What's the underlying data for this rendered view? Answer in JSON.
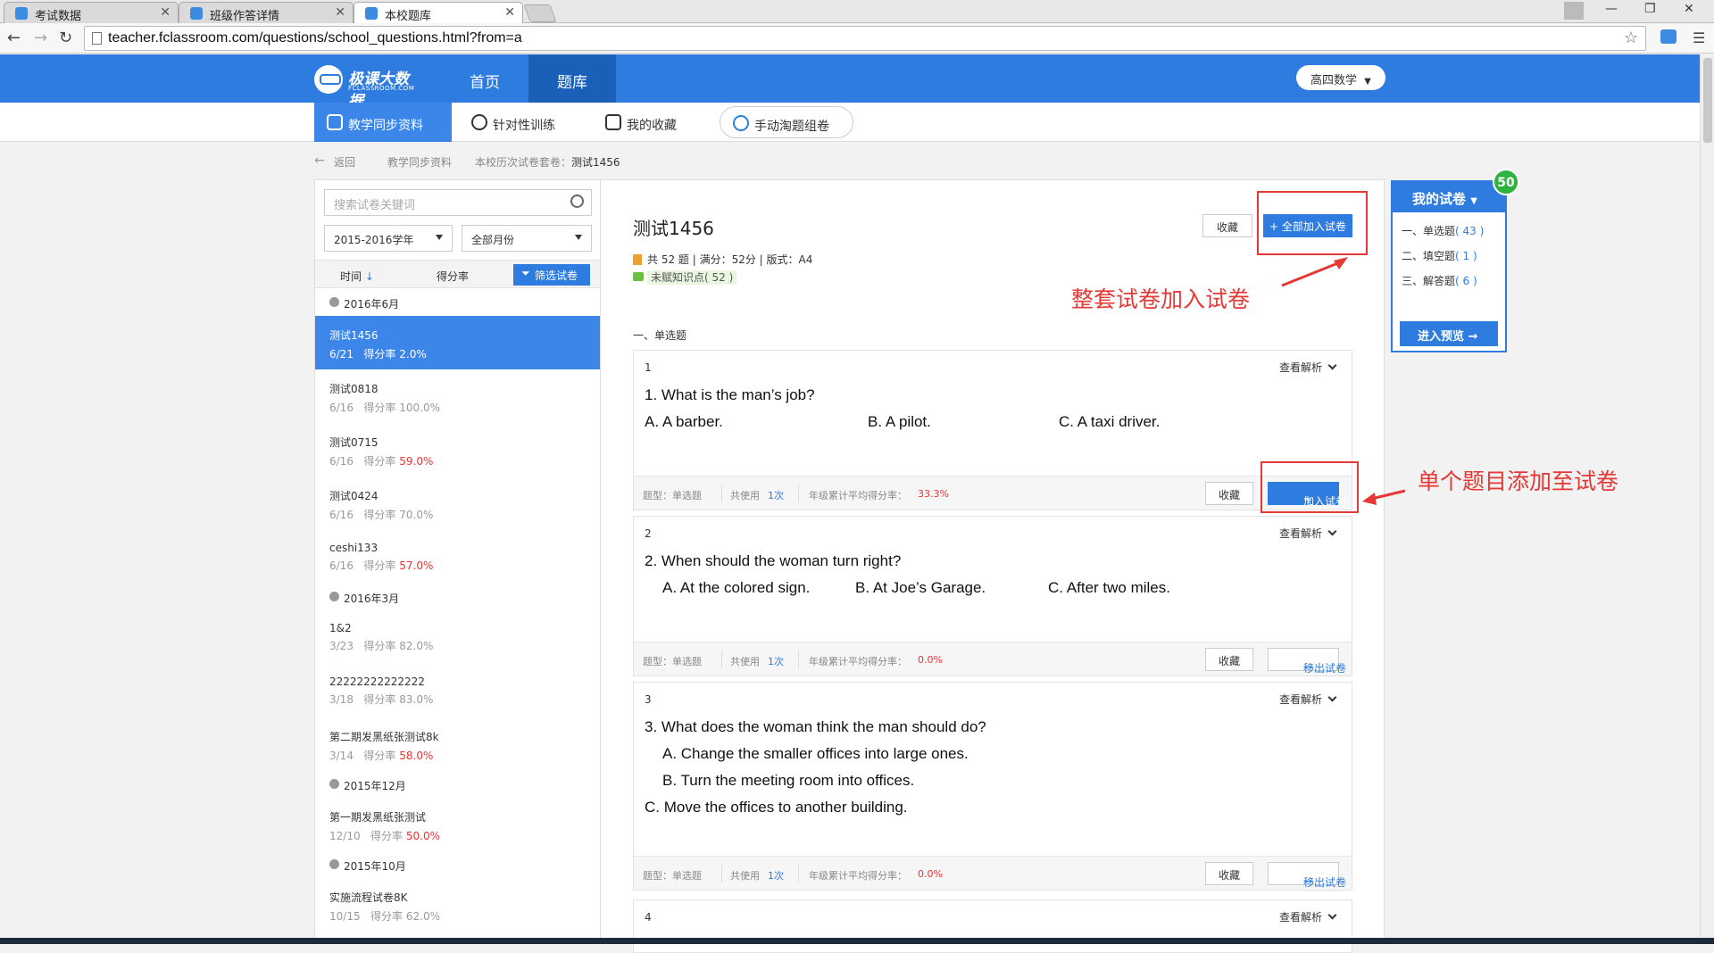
{
  "browser": {
    "tabs": [
      {
        "label": "考试数据"
      },
      {
        "label": "班级作答详情"
      },
      {
        "label": "本校题库"
      }
    ],
    "url": "teacher.fclassroom.com/questions/school_questions.html?from=a"
  },
  "header": {
    "brand": "极课大数据",
    "brand_sub": "FCLASSROOM.COM",
    "nav": [
      {
        "label": "首页"
      },
      {
        "label": "题库"
      }
    ],
    "grade_select": "高四数学"
  },
  "subnav": [
    {
      "label": "教学同步资料"
    },
    {
      "label": "针对性训练"
    },
    {
      "label": "我的收藏"
    },
    {
      "label": "手动淘题组卷"
    }
  ],
  "breadcrumb": {
    "back": "返回",
    "path1": "教学同步资料",
    "path2": "本校历次试卷套卷：",
    "current": "测试1456"
  },
  "sidebar": {
    "search_placeholder": "搜索试卷关键词",
    "year": "2015-2016学年",
    "month": "全部月份",
    "sort_time": "时间",
    "sort_score": "得分率",
    "filter_label": "筛选试卷",
    "groups": [
      {
        "month": "2016年6月",
        "items": [
          {
            "name": "测试1456",
            "date": "6/21",
            "rate_label": "得分率",
            "rate": "2.0%"
          },
          {
            "name": "测试0818",
            "date": "6/16",
            "rate_label": "得分率",
            "rate": "100.0%"
          },
          {
            "name": "测试0715",
            "date": "6/16",
            "rate_label": "得分率",
            "rate": "59.0%"
          },
          {
            "name": "测试0424",
            "date": "6/16",
            "rate_label": "得分率",
            "rate": "70.0%"
          },
          {
            "name": "ceshi133",
            "date": "6/16",
            "rate_label": "得分率",
            "rate": "57.0%"
          }
        ]
      },
      {
        "month": "2016年3月",
        "items": [
          {
            "name": "1&2",
            "date": "3/23",
            "rate_label": "得分率",
            "rate": "82.0%"
          },
          {
            "name": "22222222222222",
            "date": "3/18",
            "rate_label": "得分率",
            "rate": "83.0%"
          },
          {
            "name": "第二期发黑纸张测试8k",
            "date": "3/14",
            "rate_label": "得分率",
            "rate": "58.0%"
          }
        ]
      },
      {
        "month": "2015年12月",
        "items": [
          {
            "name": "第一期发黑纸张测试",
            "date": "12/10",
            "rate_label": "得分率",
            "rate": "50.0%"
          }
        ]
      },
      {
        "month": "2015年10月",
        "items": [
          {
            "name": "实施流程试卷8K",
            "date": "10/15",
            "rate_label": "得分率",
            "rate": "62.0%"
          }
        ]
      }
    ]
  },
  "paper": {
    "title": "测试1456",
    "meta": "共 52 题  |  满分：52分  |  版式：A4",
    "tag": "未赋知识点( 52 )",
    "fav_label": "收藏",
    "add_all_label": "全部加入试卷",
    "section": "一、单选题"
  },
  "questions": [
    {
      "num": "1",
      "analysis": "查看解析",
      "lines": [
        "1. What is the man’s job?"
      ],
      "options": [
        "A. A barber.",
        "B. A pilot.",
        "C. A taxi driver."
      ],
      "type_label": "题型：单选题",
      "used_prefix": "共使用",
      "used_count": "1次",
      "avg_label": "年级累计平均得分率：",
      "avg": "33.3%",
      "fav": "收藏",
      "action": "加入试卷"
    },
    {
      "num": "2",
      "analysis": "查看解析",
      "lines": [
        "2. When should the woman turn right?"
      ],
      "options": [
        "A. At the colored sign.",
        "B. At Joe’s Garage.",
        "C. After two miles."
      ],
      "type_label": "题型：单选题",
      "used_prefix": "共使用",
      "used_count": "1次",
      "avg_label": "年级累计平均得分率：",
      "avg": "0.0%",
      "fav": "收藏",
      "action": "移出试卷"
    },
    {
      "num": "3",
      "analysis": "查看解析",
      "lines": [
        "3. What does the woman think the man should do?",
        "A. Change the smaller offices into large ones.",
        "B. Turn the meeting room into offices.",
        "C. Move the offices to another building."
      ],
      "type_label": "题型：单选题",
      "used_prefix": "共使用",
      "used_count": "1次",
      "avg_label": "年级累计平均得分率：",
      "avg": "0.0%",
      "fav": "收藏",
      "action": "移出试卷"
    },
    {
      "num": "4",
      "analysis": "查看解析"
    }
  ],
  "annotations": {
    "whole_paper": "整套试卷加入试卷",
    "single_question": "单个题目添加至试卷"
  },
  "my_paper": {
    "title": "我的试卷",
    "badge": "50",
    "rows": [
      {
        "label": "一、单选题",
        "count": "( 43 )"
      },
      {
        "label": "二、填空题",
        "count": "( 1 )"
      },
      {
        "label": "三、解答题",
        "count": "( 6 )"
      }
    ],
    "preview": "进入预览"
  },
  "colors": {
    "accent": "#2e7ce0",
    "annotation": "#e53935",
    "badge": "#2eb33e"
  }
}
